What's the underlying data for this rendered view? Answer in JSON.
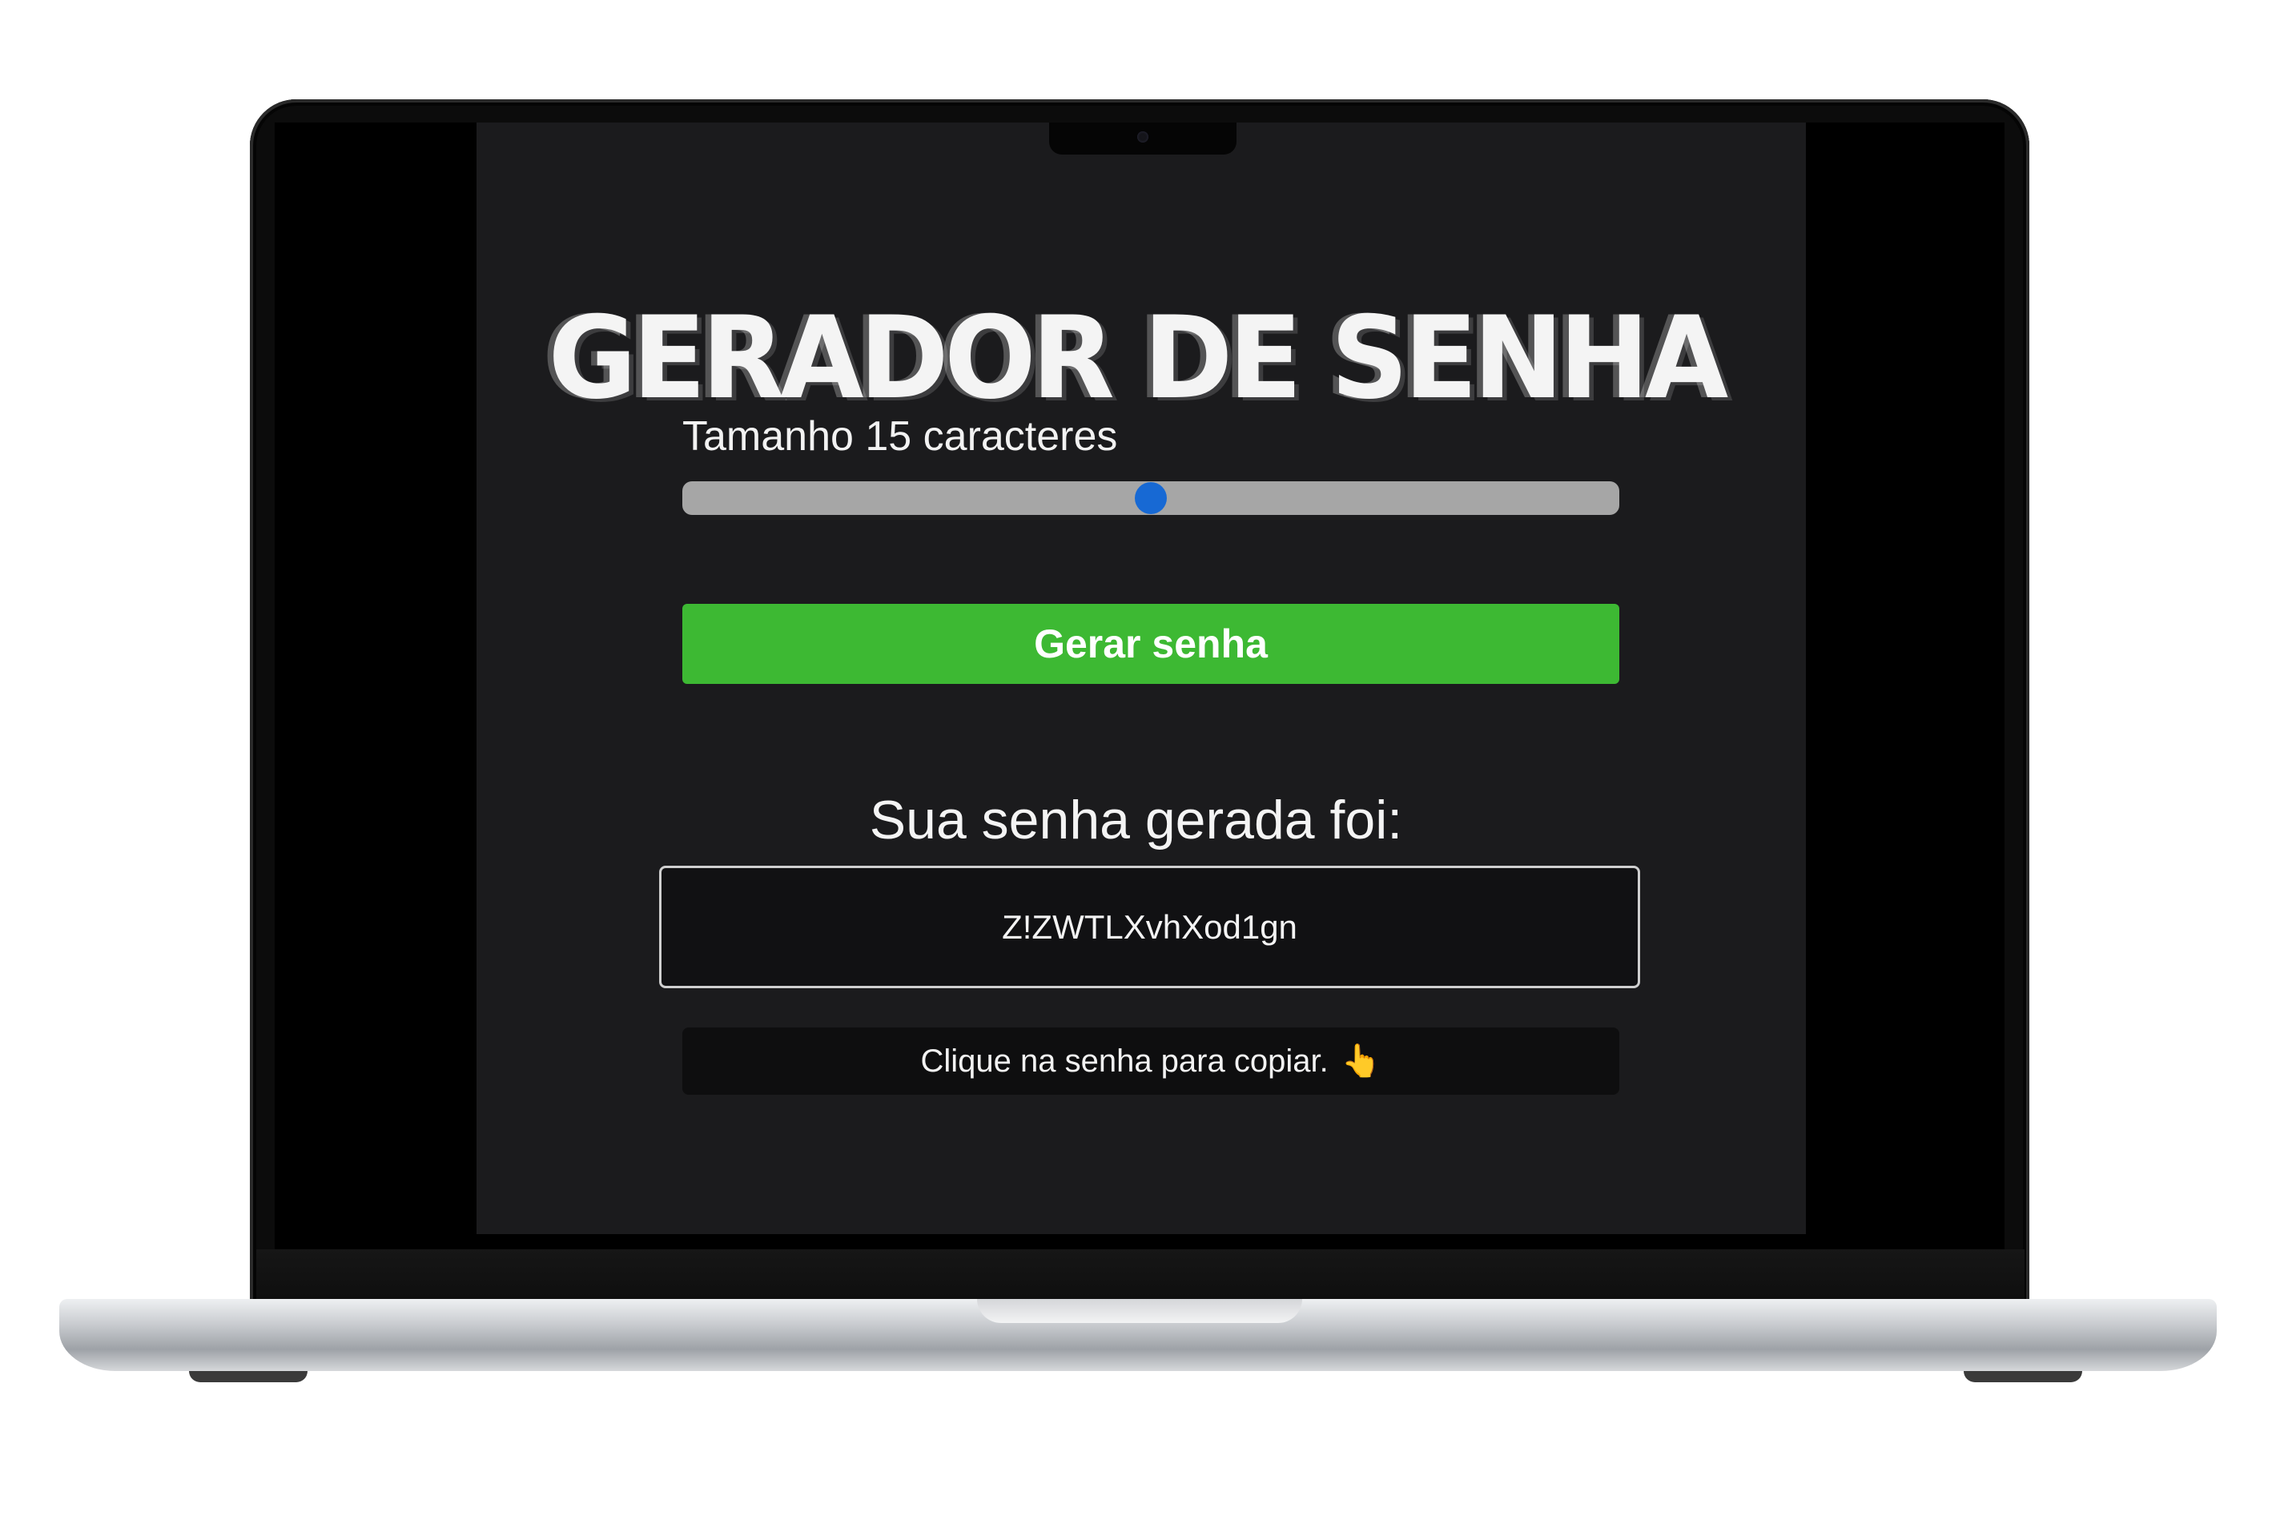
{
  "header": {
    "title": "GERADOR DE SENHA"
  },
  "length_control": {
    "label": "Tamanho 15 caracteres",
    "value": 15,
    "fraction": 0.5
  },
  "actions": {
    "generate_label": "Gerar senha"
  },
  "result": {
    "heading": "Sua senha gerada foi:",
    "password": "Z!ZWTLXvhXod1gn",
    "hint": "Clique na senha para copiar.",
    "hint_emoji": "👆"
  },
  "colors": {
    "page_background": "#1b1b1d",
    "button": "#3db933",
    "slider_thumb": "#1769d4",
    "slider_track": "#a6a6a6"
  }
}
